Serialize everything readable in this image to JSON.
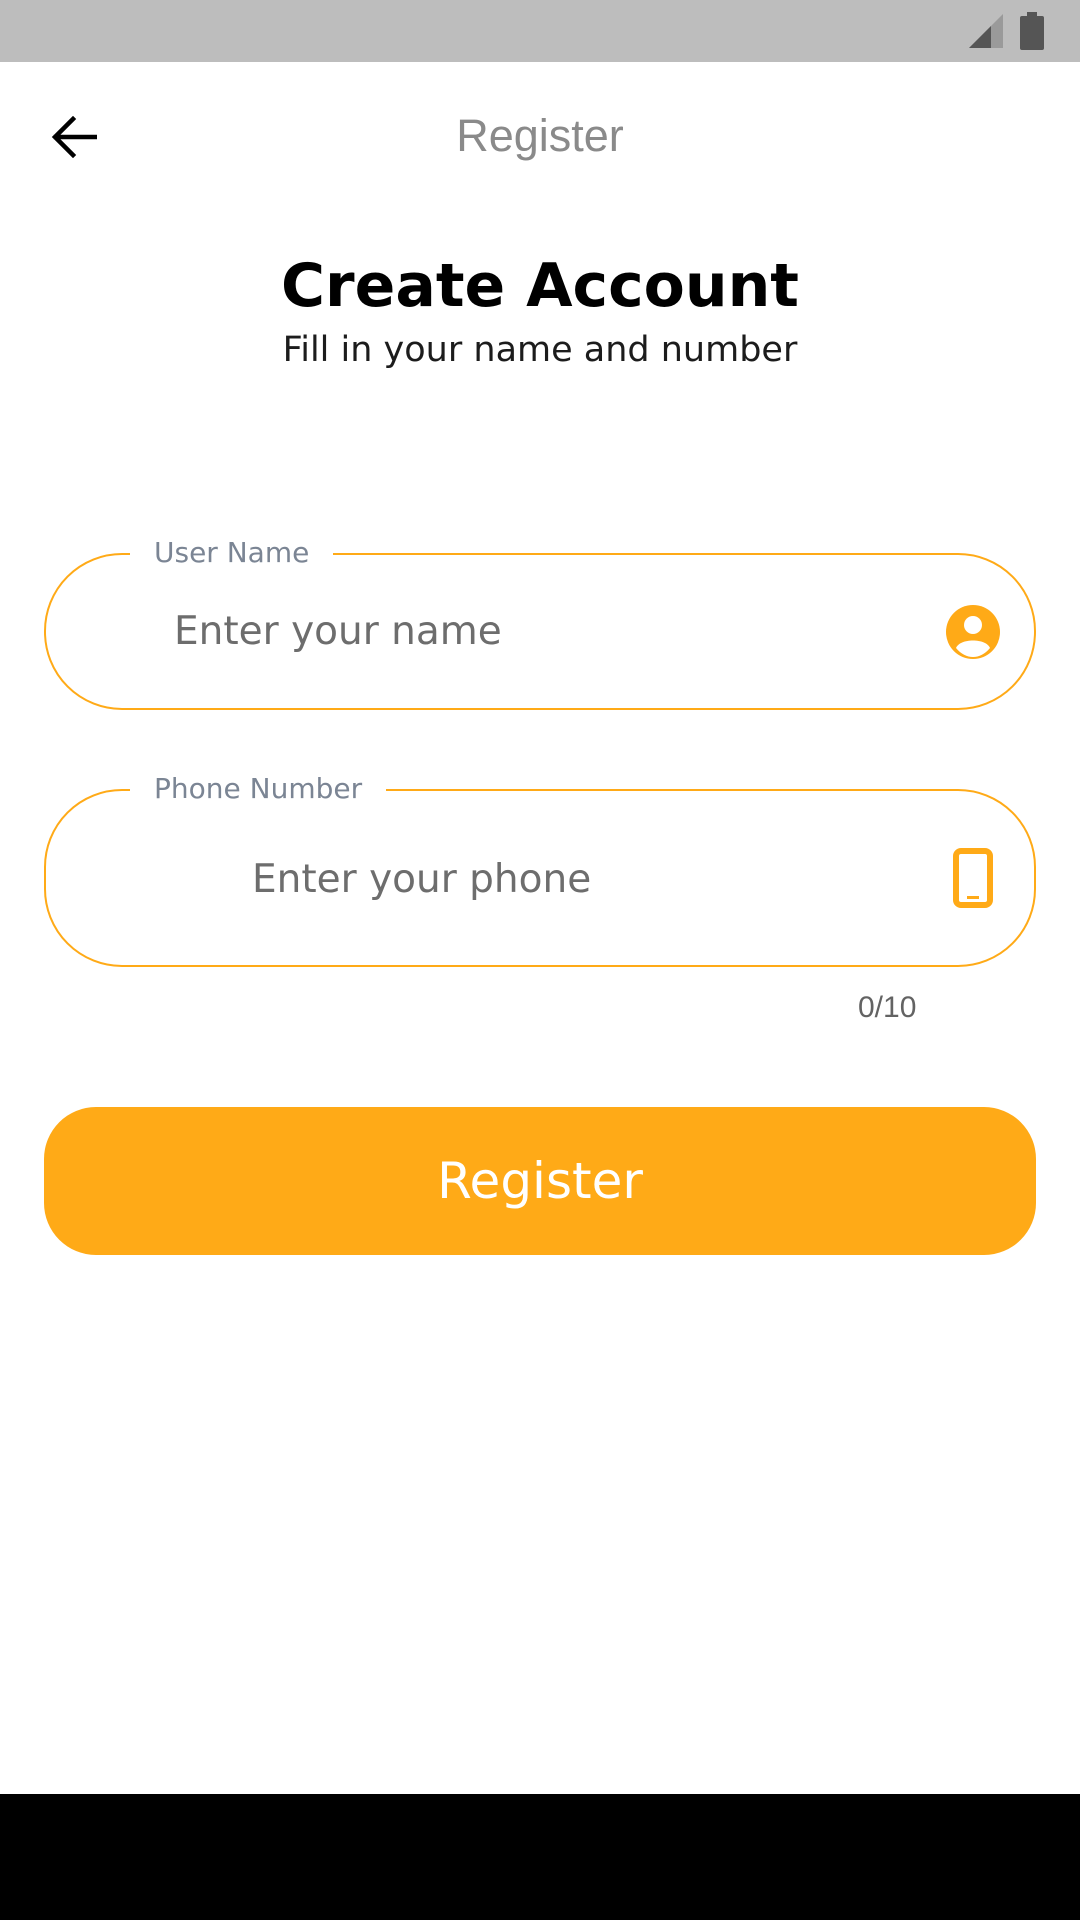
{
  "app_bar": {
    "title": "Register"
  },
  "header": {
    "title": "Create Account",
    "subtitle": "Fill in your name and number"
  },
  "form": {
    "name_field": {
      "label": "User Name",
      "placeholder": "Enter your name",
      "value": "",
      "icon": "account-circle-icon"
    },
    "phone_field": {
      "label": "Phone Number",
      "placeholder": "Enter your phone",
      "value": "",
      "icon": "smartphone-icon",
      "counter": "0/10"
    },
    "submit_label": "Register"
  },
  "colors": {
    "accent": "#ffaa17",
    "status_bar": "#bdbdbd",
    "title_gray": "#8a8a8a",
    "label_gray": "#7b8594",
    "nav_bar": "#000000"
  },
  "status_bar": {
    "icons": [
      "signal-icon",
      "battery-icon"
    ]
  }
}
